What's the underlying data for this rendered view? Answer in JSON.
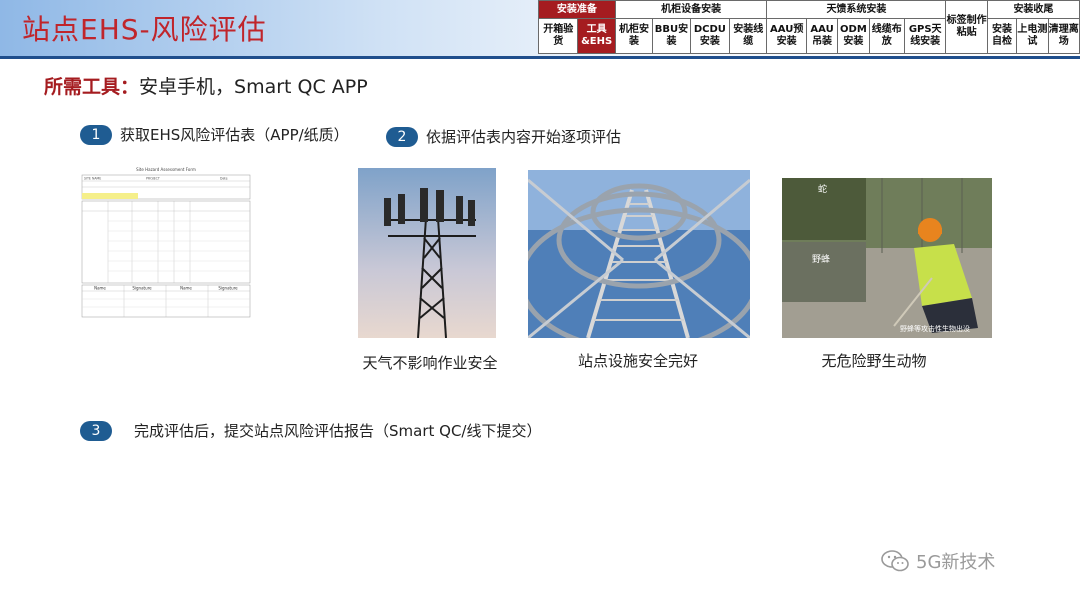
{
  "page_title": "站点EHS-风险评估",
  "nav": {
    "categories": [
      "安装准备",
      "机柜设备安装",
      "天馈系统安装",
      "标签制作粘贴",
      "安装收尾"
    ],
    "items": [
      "开箱验货",
      "工具&EHS",
      "机柜安装",
      "BBU安装",
      "DCDU安装",
      "安装线缆",
      "AAU预安装",
      "AAU吊装",
      "ODM安装",
      "线缆布放",
      "GPS天线安装",
      "安装自检",
      "上电测试",
      "清理离场"
    ],
    "active_item": "工具&EHS"
  },
  "tools": {
    "label": "所需工具：",
    "value": "安卓手机，Smart QC APP"
  },
  "steps": [
    {
      "num": "1",
      "text": "获取EHS风险评估表（APP/纸质）"
    },
    {
      "num": "2",
      "text": "依据评估表内容开始逐项评估"
    },
    {
      "num": "3",
      "text": "完成评估后，提交站点风险评估报告（Smart QC/线下提交）"
    }
  ],
  "photos": [
    {
      "caption": "天气不影响作业安全"
    },
    {
      "caption": "站点设施安全完好"
    },
    {
      "caption": "无危险野生动物",
      "label_top": "蛇",
      "label_mid": "野蜂",
      "label_bottom": "野蜂等攻击性生物出没"
    }
  ],
  "document_form": {
    "header": "Site Hazard Assessment Form",
    "row_labels": [
      "SITE NAME",
      "PROJECT",
      "Date"
    ],
    "sign_headers": [
      "Name",
      "Signature",
      "Name",
      "Signature"
    ]
  },
  "watermark": "5G新技术",
  "colors": {
    "accent_red": "#a51c20",
    "badge_blue": "#1f5c92",
    "title_red": "#c0252b"
  }
}
